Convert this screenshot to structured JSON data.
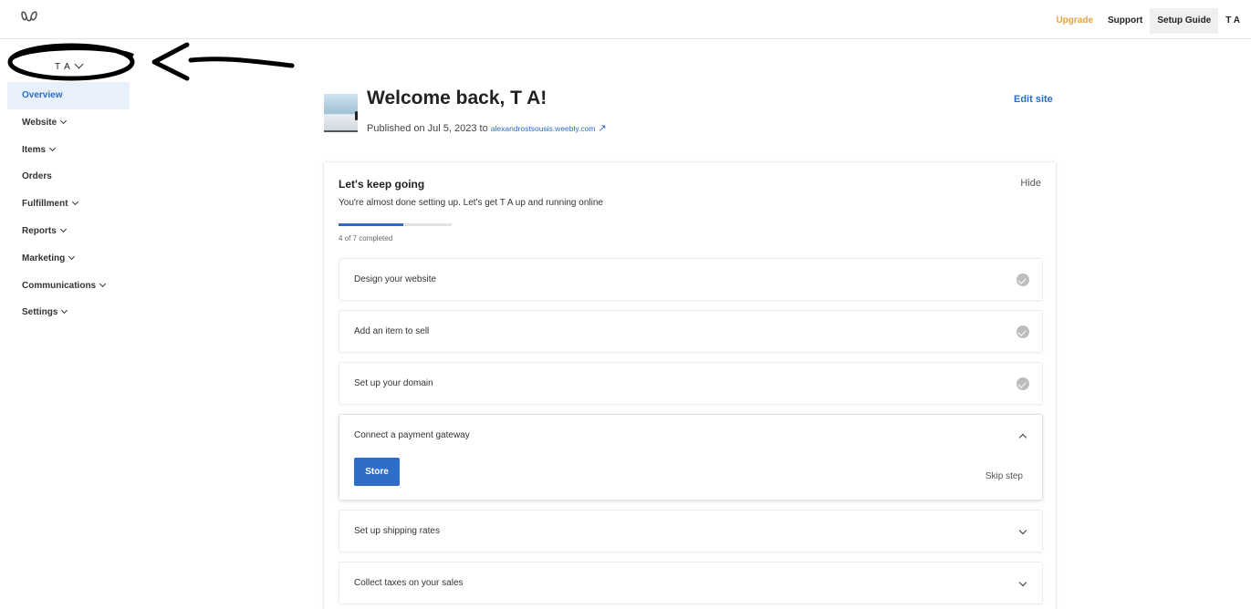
{
  "topbar": {
    "logo_icon": "weebly-logo-icon",
    "upgrade": "Upgrade",
    "support": "Support",
    "setup_guide": "Setup Guide",
    "account": "T A"
  },
  "sidebar": {
    "account_switcher": "T A",
    "items": [
      {
        "label": "Overview",
        "active": true,
        "has_chevron": false
      },
      {
        "label": "Website",
        "active": false,
        "has_chevron": true
      },
      {
        "label": "Items",
        "active": false,
        "has_chevron": true
      },
      {
        "label": "Orders",
        "active": false,
        "has_chevron": false
      },
      {
        "label": "Fulfillment",
        "active": false,
        "has_chevron": true
      },
      {
        "label": "Reports",
        "active": false,
        "has_chevron": true
      },
      {
        "label": "Marketing",
        "active": false,
        "has_chevron": true
      },
      {
        "label": "Communications",
        "active": false,
        "has_chevron": true
      },
      {
        "label": "Settings",
        "active": false,
        "has_chevron": true
      }
    ]
  },
  "main": {
    "welcome": "Welcome back, T A!",
    "published_prefix": "Published on Jul 5, 2023 to",
    "site_url": "alexandrostsousis.weebly.com",
    "edit_site": "Edit site"
  },
  "setup": {
    "title": "Let's keep going",
    "hide": "Hide",
    "subtitle": "You're almost done setting up. Let's get T A up and running online",
    "progress_fraction": 0.57,
    "progress_label": "4 of 7 completed",
    "steps": [
      {
        "label": "Design your website",
        "state": "done"
      },
      {
        "label": "Add an item to sell",
        "state": "done"
      },
      {
        "label": "Set up your domain",
        "state": "done"
      },
      {
        "label": "Connect a payment gateway",
        "state": "expanded",
        "button": "Store",
        "skip": "Skip step"
      },
      {
        "label": "Set up shipping rates",
        "state": "collapsed"
      },
      {
        "label": "Collect taxes on your sales",
        "state": "collapsed"
      }
    ]
  },
  "colors": {
    "accent": "#2b6cc4",
    "upgrade": "#e8a33c",
    "active_nav_bg": "#e8f1fb"
  }
}
